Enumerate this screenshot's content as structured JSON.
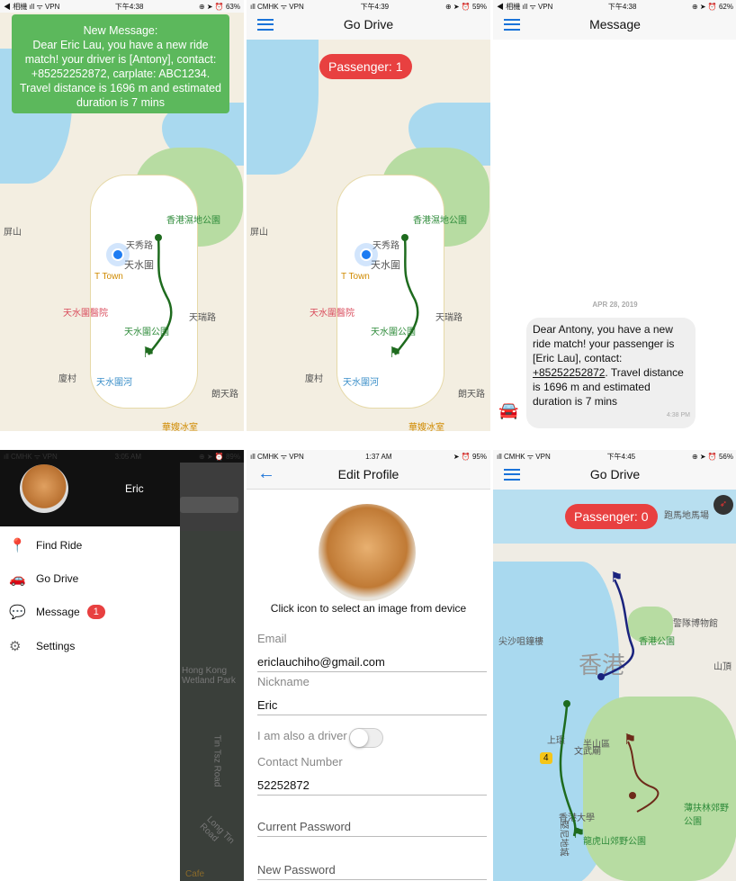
{
  "panel1": {
    "status": {
      "left": "◀ 相機 ıll ᯤ VPN",
      "time": "下午4:38",
      "right": "⊕ ➤ ⏰ 63%"
    },
    "notification": {
      "title": "New Message:",
      "body": "Dear Eric Lau, you have a new ride match! your driver is [Antony], contact: +85252252872, carplate: ABC1234. Travel distance is 1696 m and estimated duration is 7 mins"
    },
    "map_labels": [
      "香港濕地公園",
      "天秀路",
      "天水圍",
      "T Town",
      "天水圍醫院",
      "天水圍公園",
      "天水圍河",
      "天瑞路",
      "屏山",
      "廈村",
      "朗天路",
      "華嫂冰室"
    ]
  },
  "panel2": {
    "status": {
      "left": "ıll CMHK ᯤ VPN",
      "time": "下午4:39",
      "right": "⊕ ➤ ⏰ 59%"
    },
    "title": "Go Drive",
    "passenger": "Passenger: 1",
    "map_labels": [
      "香港濕地公園",
      "天秀路",
      "天水圍",
      "T Town",
      "天水圍醫院",
      "天水圍公園",
      "天水圍河",
      "天瑞路",
      "屏山",
      "廈村",
      "朗天路",
      "華嫂冰室"
    ]
  },
  "panel3": {
    "status": {
      "left": "◀ 相機 ıll ᯤ VPN",
      "time": "下午4:38",
      "right": "⊕ ➤ ⏰ 62%"
    },
    "title": "Message",
    "date": "APR 28, 2019",
    "message": {
      "pre": "Dear Antony, you have a new ride match! your passenger is [Eric Lau], contact: ",
      "phone": "+85252252872",
      "post": ". Travel distance is 1696 m and estimated duration is 7 mins",
      "time": "4:38 PM"
    }
  },
  "panel4": {
    "status": {
      "left": "ıll CMHK ᯤ VPN",
      "time": "3:05 AM",
      "right": "⊕ ➤ ⏰ 89%"
    },
    "user": "Eric",
    "menu": [
      {
        "label": "Find Ride",
        "icon": "map-pin-icon"
      },
      {
        "label": "Go Drive",
        "icon": "car-icon"
      },
      {
        "label": "Message",
        "icon": "chat-icon",
        "badge": "1"
      },
      {
        "label": "Settings",
        "icon": "gear-icon"
      }
    ],
    "map_labels": [
      "Hong Kong Wetland Park",
      "Tin Tsz Road",
      "Long Tin Road",
      "Cafe"
    ]
  },
  "panel5": {
    "status": {
      "left": "ıll CMHK ᯤ VPN",
      "time": "1:37 AM",
      "right": "➤ ⏰ 95%"
    },
    "title": "Edit Profile",
    "hint": "Click icon to select an image from device",
    "email_label": "Email",
    "email": "ericlauchiho@gmail.com",
    "nickname_label": "Nickname",
    "nickname": "Eric",
    "driver_label": "I am also a driver",
    "driver_on": false,
    "contact_label": "Contact Number",
    "contact": "52252872",
    "current_pw_label": "Current Password",
    "new_pw_label": "New Password"
  },
  "panel6": {
    "status": {
      "left": "ıll CMHK ᯤ VPN",
      "time": "下午4:45",
      "right": "⊕ ➤ ⏰ 56%"
    },
    "title": "Go Drive",
    "passenger": "Passenger: 0",
    "map_labels": [
      "跑馬地馬場",
      "香港",
      "香港公園",
      "警隊博物館",
      "山頂",
      "半山區",
      "薄扶林郊野公園",
      "龍虎山郊野公園",
      "香港大學",
      "尖沙咀鐘樓",
      "文武廟",
      "上環",
      "堅尼地城",
      "4"
    ]
  },
  "colors": {
    "accent": "#1a73d9",
    "notification": "#5cb85c",
    "badge": "#e84040",
    "route_green": "#1e6b1e",
    "route_blue": "#1a237e",
    "route_brown": "#6d2a1a"
  }
}
